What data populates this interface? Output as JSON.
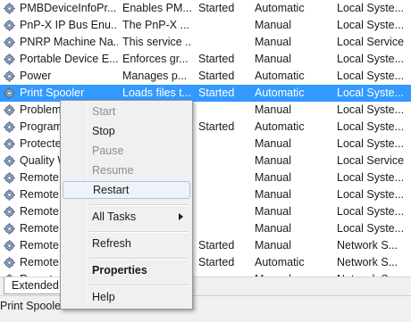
{
  "services": [
    {
      "name": "PMBDeviceInfoPr...",
      "description": "Enables PM...",
      "status": "Started",
      "startup": "Automatic",
      "logon": "Local Syste..."
    },
    {
      "name": "PnP-X IP Bus Enu...",
      "description": "The PnP-X ...",
      "status": "",
      "startup": "Manual",
      "logon": "Local Syste..."
    },
    {
      "name": "PNRP Machine Na...",
      "description": "This service ...",
      "status": "",
      "startup": "Manual",
      "logon": "Local Service"
    },
    {
      "name": "Portable Device E...",
      "description": "Enforces gr...",
      "status": "Started",
      "startup": "Manual",
      "logon": "Local Syste..."
    },
    {
      "name": "Power",
      "description": "Manages p...",
      "status": "Started",
      "startup": "Automatic",
      "logon": "Local Syste..."
    },
    {
      "name": "Print Spooler",
      "description": "Loads files t...",
      "status": "Started",
      "startup": "Automatic",
      "logon": "Local Syste..."
    },
    {
      "name": "Problem",
      "description": "",
      "status": "",
      "startup": "Manual",
      "logon": "Local Syste..."
    },
    {
      "name": "Program",
      "description": "",
      "status": "Started",
      "startup": "Automatic",
      "logon": "Local Syste..."
    },
    {
      "name": "Protecte",
      "description": "",
      "status": "",
      "startup": "Manual",
      "logon": "Local Syste..."
    },
    {
      "name": "Quality W",
      "description": "",
      "status": "",
      "startup": "Manual",
      "logon": "Local Service"
    },
    {
      "name": "Remote A",
      "description": "",
      "status": "",
      "startup": "Manual",
      "logon": "Local Syste..."
    },
    {
      "name": "Remote A",
      "description": "",
      "status": "",
      "startup": "Manual",
      "logon": "Local Syste..."
    },
    {
      "name": "Remote D",
      "description": "",
      "status": "",
      "startup": "Manual",
      "logon": "Local Syste..."
    },
    {
      "name": "Remote D",
      "description": "",
      "status": "",
      "startup": "Manual",
      "logon": "Local Syste..."
    },
    {
      "name": "Remote D",
      "description": "",
      "status": "Started",
      "startup": "Manual",
      "logon": "Network S..."
    },
    {
      "name": "Remote P",
      "description": "",
      "status": "Started",
      "startup": "Automatic",
      "logon": "Network S..."
    },
    {
      "name": "Remote R",
      "description": "",
      "status": "",
      "startup": "Manual",
      "logon": "Network S..."
    }
  ],
  "selected_index": 5,
  "tabs": {
    "extended": "Extended"
  },
  "status_bar": {
    "text": "Print Spooler"
  },
  "context_menu": {
    "start": "Start",
    "stop": "Stop",
    "pause": "Pause",
    "resume": "Resume",
    "restart": "Restart",
    "all_tasks": "All Tasks",
    "refresh": "Refresh",
    "properties": "Properties",
    "help": "Help"
  },
  "colors": {
    "selection": "#3399ff",
    "menu_bg": "#f0f0f0",
    "disabled_text": "#8d8d8d"
  },
  "icons": {
    "service": "gear-icon",
    "submenu": "chevron-right-icon"
  }
}
